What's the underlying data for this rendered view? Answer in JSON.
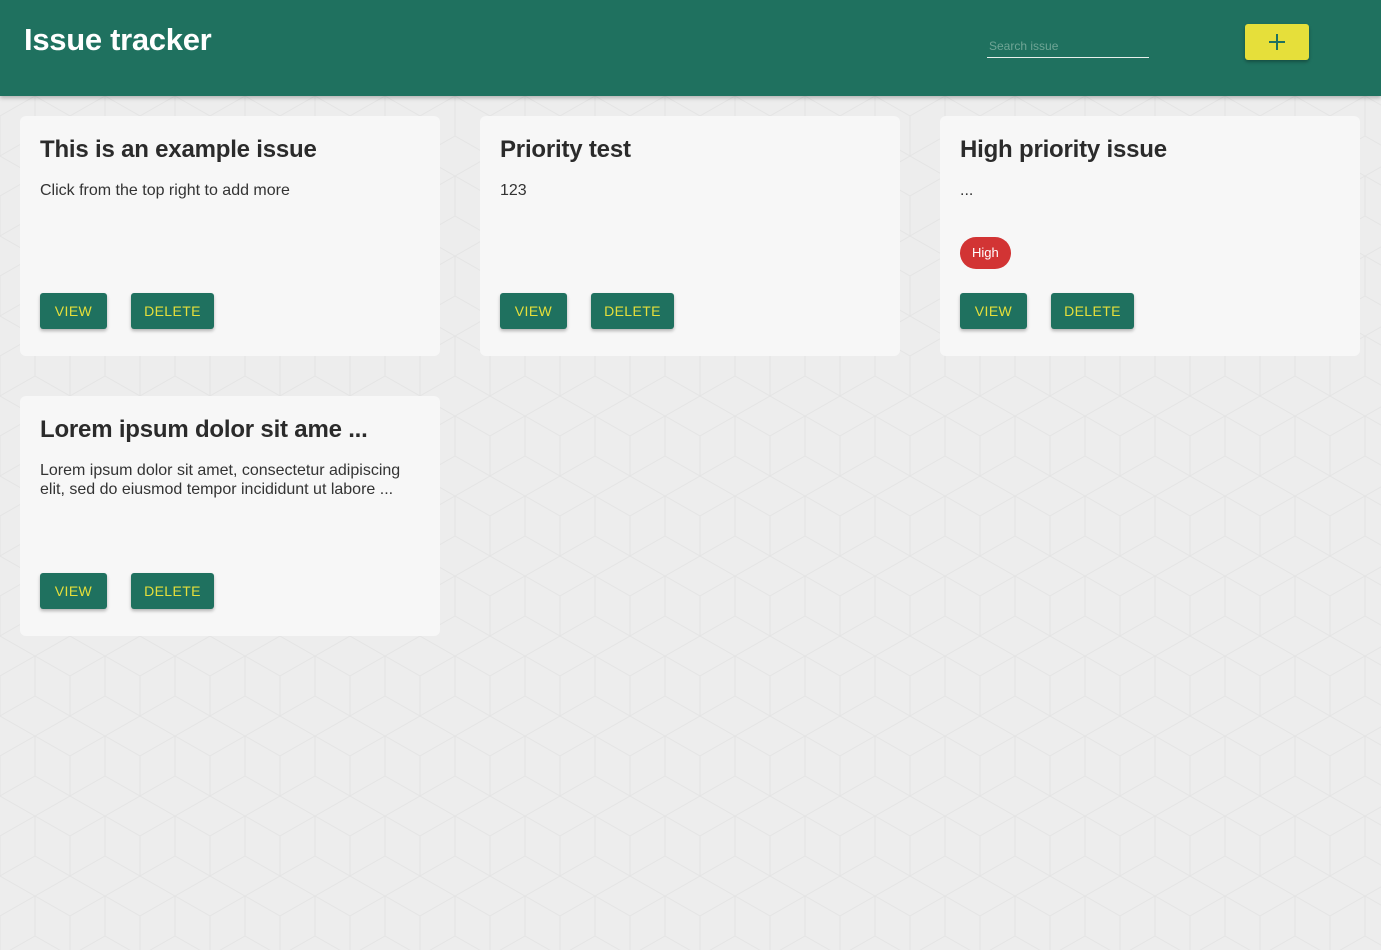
{
  "header": {
    "title": "Issue tracker",
    "search_placeholder": "Search issue",
    "search_value": "",
    "add_icon": "plus-icon"
  },
  "colors": {
    "primary": "#1f715f",
    "accent": "#e6df3a",
    "card_bg": "#f7f7f7",
    "page_bg": "#ededed",
    "priority_high": "#d23434"
  },
  "issues": [
    {
      "title": "This is an example issue",
      "description": "Click from the top right to add more",
      "priority": "",
      "view_label": "VIEW",
      "delete_label": "DELETE"
    },
    {
      "title": "Priority test",
      "description": "123",
      "priority": "",
      "view_label": "VIEW",
      "delete_label": "DELETE"
    },
    {
      "title": "High priority issue",
      "description": "...",
      "priority": "High",
      "view_label": "VIEW",
      "delete_label": "DELETE"
    },
    {
      "title": "Lorem ipsum dolor sit ame ...",
      "description": "Lorem ipsum dolor sit amet, consectetur adipiscing elit, sed do eiusmod tempor incididunt ut labore ...",
      "priority": "",
      "view_label": "VIEW",
      "delete_label": "DELETE"
    }
  ]
}
